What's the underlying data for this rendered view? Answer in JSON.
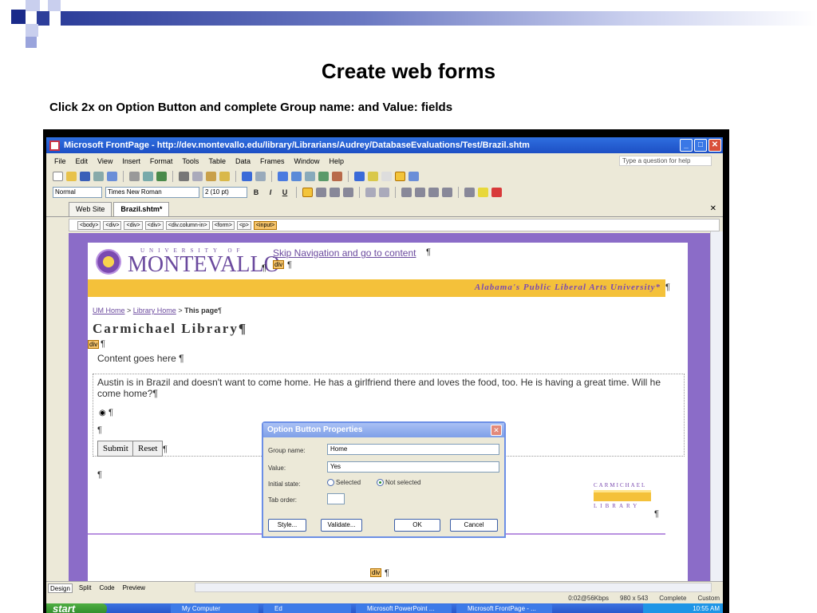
{
  "slide": {
    "title": "Create web forms",
    "subtitle": "Click 2x on Option Button and complete Group name: and Value: fields",
    "accent_color": "#2d3e9a"
  },
  "window": {
    "title": "Microsoft FrontPage - http://dev.montevallo.edu/library/Librarians/Audrey/DatabaseEvaluations/Test/Brazil.shtm",
    "minimize_icon": "minimize-icon",
    "maximize_icon": "maximize-icon",
    "close_icon": "close-icon"
  },
  "menu": {
    "items": [
      "File",
      "Edit",
      "View",
      "Insert",
      "Format",
      "Tools",
      "Table",
      "Data",
      "Frames",
      "Window",
      "Help"
    ],
    "ask_placeholder": "Type a question for help"
  },
  "format_toolbar": {
    "style": "Normal",
    "font": "Times New Roman",
    "size": "2 (10 pt)",
    "bold": "B",
    "italic": "I",
    "underline": "U"
  },
  "doc_tabs": [
    "Web Site",
    "Brazil.shtm*"
  ],
  "tag_selector": [
    "<body>",
    "<div>",
    "<div>",
    "<div>",
    "<div.column-in>",
    "<form>",
    "<p>",
    "<input>"
  ],
  "page": {
    "logo_small": "UNIVERSITY OF",
    "logo_big": "MONTEVALLO",
    "skip_nav": "Skip Navigation and go to content",
    "tagline": "Alabama's Public Liberal Arts University*",
    "crumb_home": "UM Home",
    "crumb_library": "Library Home",
    "crumb_sep": " > ",
    "crumb_current": "This page",
    "library_title": "Carmichael Library",
    "content_here": "Content goes here",
    "austin_text": "Austin is in Brazil and doesn't want to come home.  He has a girlfriend there and loves the food, too.  He is having a great time.  Will he come home?",
    "submit_label": "Submit",
    "reset_label": "Reset",
    "div_marker": "div",
    "pilcrow": "¶",
    "carmichael_logo_top": "CARMICHAEL",
    "carmichael_logo_bottom": "LIBRARY"
  },
  "dialog": {
    "title": "Option Button Properties",
    "group_name_label": "Group name:",
    "group_name_value": "Home",
    "value_label": "Value:",
    "value_value": "Yes",
    "initial_state_label": "Initial state:",
    "selected_label": "Selected",
    "not_selected_label": "Not selected",
    "initial_state": "Not selected",
    "tab_order_label": "Tab order:",
    "tab_order_value": "",
    "style_button": "Style...",
    "validate_button": "Validate...",
    "ok_button": "OK",
    "cancel_button": "Cancel"
  },
  "view_tabs": [
    "Design",
    "Split",
    "Code",
    "Preview"
  ],
  "status": {
    "speed": "0:02@56Kbps",
    "dims": "980 x 543",
    "state": "Complete",
    "custom": "Custom"
  },
  "taskbar": {
    "start": "start",
    "tasks": [
      "My Computer",
      "Ed",
      "Microsoft PowerPoint ...",
      "Microsoft FrontPage - ..."
    ],
    "clock": "10:55 AM"
  }
}
